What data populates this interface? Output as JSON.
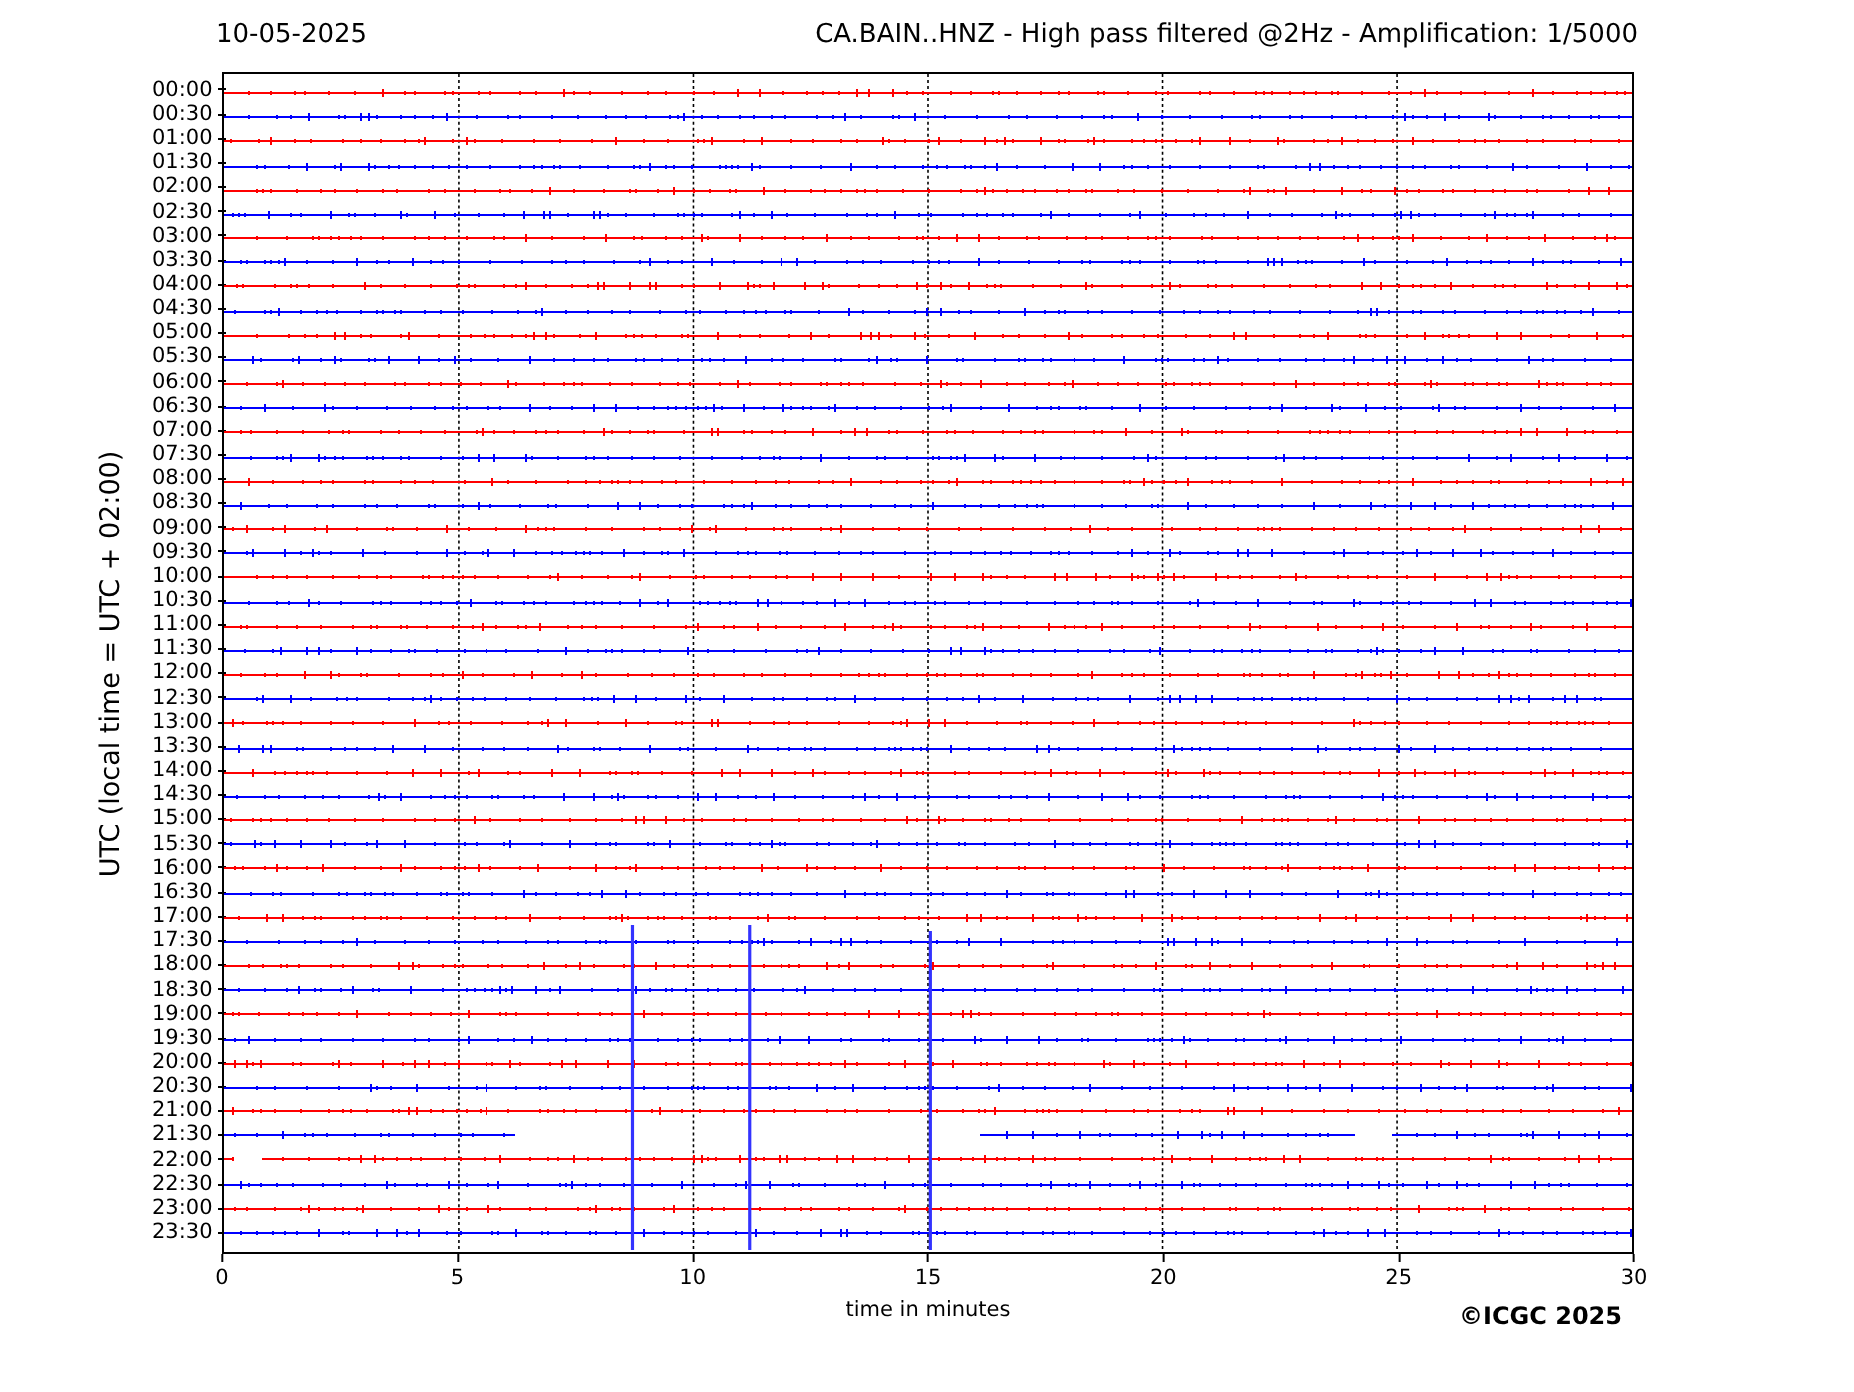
{
  "date": "10-05-2025",
  "title": "CA.BAIN..HNZ - High pass filtered @2Hz - Amplification: 1/5000",
  "ylabel": "UTC (local time = UTC + 02:00)",
  "rows": [
    {
      "label": "00:00",
      "color": "#ff0000"
    },
    {
      "label": "00:30",
      "color": "#0000ff"
    },
    {
      "label": "01:00",
      "color": "#ff0000"
    },
    {
      "label": "01:30",
      "color": "#0000ff"
    },
    {
      "label": "02:00",
      "color": "#ff0000"
    },
    {
      "label": "02:30",
      "color": "#0000ff"
    },
    {
      "label": "03:00",
      "color": "#ff0000"
    },
    {
      "label": "03:30",
      "color": "#0000ff"
    },
    {
      "label": "04:00",
      "color": "#ff0000"
    },
    {
      "label": "04:30",
      "color": "#0000ff"
    },
    {
      "label": "05:00",
      "color": "#ff0000"
    },
    {
      "label": "05:30",
      "color": "#0000ff"
    },
    {
      "label": "06:00",
      "color": "#ff0000"
    },
    {
      "label": "06:30",
      "color": "#0000ff"
    },
    {
      "label": "07:00",
      "color": "#ff0000"
    },
    {
      "label": "07:30",
      "color": "#0000ff"
    },
    {
      "label": "08:00",
      "color": "#ff0000"
    },
    {
      "label": "08:30",
      "color": "#0000ff"
    },
    {
      "label": "09:00",
      "color": "#ff0000"
    },
    {
      "label": "09:30",
      "color": "#0000ff"
    },
    {
      "label": "10:00",
      "color": "#ff0000"
    },
    {
      "label": "10:30",
      "color": "#0000ff"
    },
    {
      "label": "11:00",
      "color": "#ff0000"
    },
    {
      "label": "11:30",
      "color": "#0000ff"
    },
    {
      "label": "12:00",
      "color": "#ff0000"
    },
    {
      "label": "12:30",
      "color": "#0000ff"
    },
    {
      "label": "13:00",
      "color": "#ff0000"
    },
    {
      "label": "13:30",
      "color": "#0000ff"
    },
    {
      "label": "14:00",
      "color": "#ff0000"
    },
    {
      "label": "14:30",
      "color": "#0000ff"
    },
    {
      "label": "15:00",
      "color": "#ff0000"
    },
    {
      "label": "15:30",
      "color": "#0000ff"
    },
    {
      "label": "16:00",
      "color": "#ff0000"
    },
    {
      "label": "16:30",
      "color": "#0000ff"
    },
    {
      "label": "17:00",
      "color": "#ff0000"
    },
    {
      "label": "17:30",
      "color": "#0000ff"
    },
    {
      "label": "18:00",
      "color": "#ff0000"
    },
    {
      "label": "18:30",
      "color": "#0000ff"
    },
    {
      "label": "19:00",
      "color": "#ff0000"
    },
    {
      "label": "19:30",
      "color": "#0000ff"
    },
    {
      "label": "20:00",
      "color": "#ff0000"
    },
    {
      "label": "20:30",
      "color": "#0000ff"
    },
    {
      "label": "21:00",
      "color": "#ff0000"
    },
    {
      "label": "21:30",
      "color": "#0000ff"
    },
    {
      "label": "22:00",
      "color": "#ff0000"
    },
    {
      "label": "22:30",
      "color": "#0000ff"
    },
    {
      "label": "23:00",
      "color": "#ff0000"
    },
    {
      "label": "23:30",
      "color": "#0000ff"
    }
  ],
  "xticks": [
    "0",
    "5",
    "10",
    "15",
    "20",
    "25",
    "30"
  ],
  "xlabel": "time in minutes",
  "copyright": "©ICGC 2025"
}
